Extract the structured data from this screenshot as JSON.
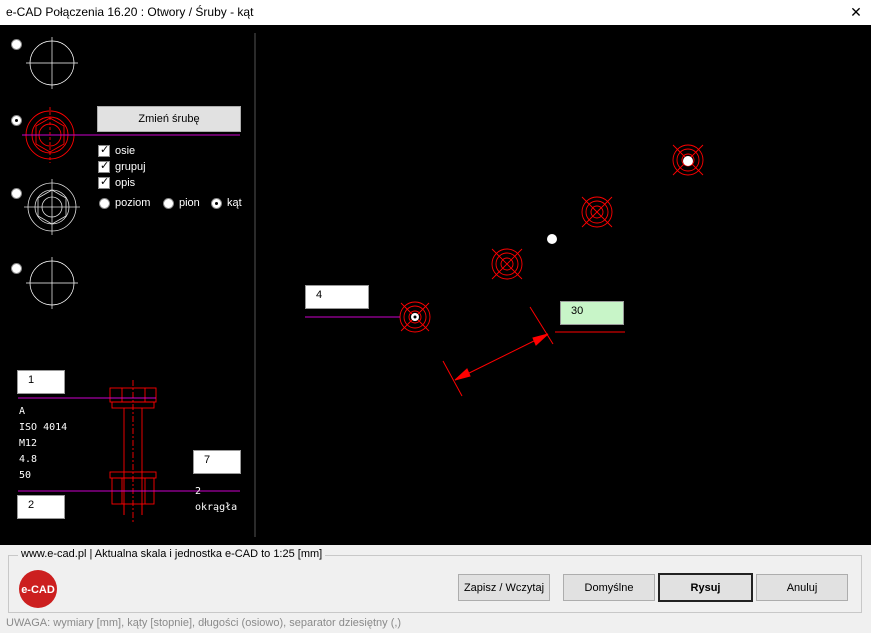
{
  "window": {
    "title": "e-CAD Połączenia 16.20 : Otwory / Śruby - kąt",
    "close_glyph": "✕"
  },
  "left_panel": {
    "change_bolt_label": "Zmień śrubę",
    "options": {
      "axes": "osie",
      "group": "grupuj",
      "description": "opis"
    },
    "orientation": {
      "horizontal": "poziom",
      "vertical": "pion",
      "angle": "kąt",
      "selected": "kąt"
    },
    "selected_variant": 2
  },
  "bolt": {
    "field_top": "1",
    "field_bottom": "2",
    "field_right": "7",
    "desc": [
      "A",
      "ISO 4014",
      "M12",
      "4.8",
      "50"
    ],
    "washer_count": "2",
    "washer_type": "okrągła"
  },
  "drawing": {
    "count_value": "4",
    "angle_value": "30"
  },
  "footer": {
    "group_label": "www.e-cad.pl | Aktualna skala i jednostka e-CAD to 1:25 [mm]",
    "logo_text": "e-CAD",
    "save_load": "Zapisz / Wczytaj",
    "defaults": "Domyślne",
    "draw": "Rysuj",
    "cancel": "Anuluj",
    "note": "UWAGA: wymiary [mm], kąty [stopnie], długości (osiowo), separator dziesiętny (,)"
  },
  "colors": {
    "canvas_bg": "#000000",
    "bolt_red": "#ff0000",
    "axis_magenta": "#cc00cc",
    "angle_field": "#c8f5c8"
  }
}
